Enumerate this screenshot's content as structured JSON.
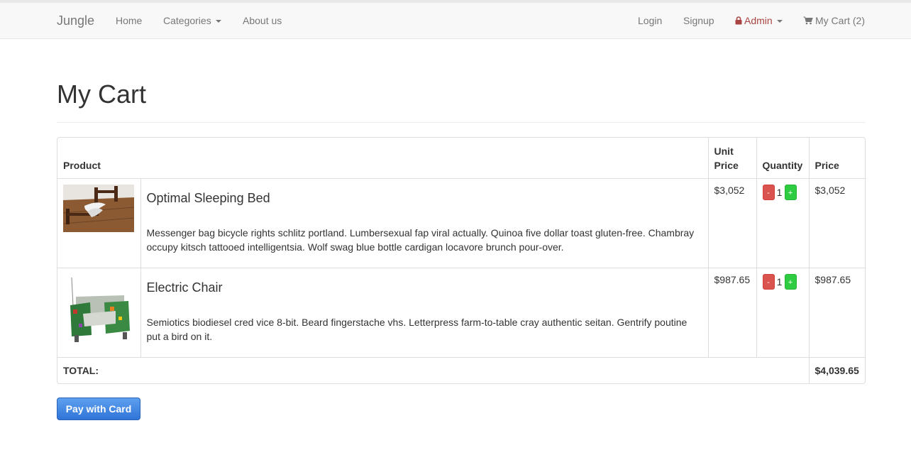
{
  "navbar": {
    "brand": "Jungle",
    "home": "Home",
    "categories": "Categories",
    "about": "About us",
    "login": "Login",
    "signup": "Signup",
    "admin": "Admin",
    "cart": "My Cart (2)"
  },
  "page": {
    "title": "My Cart"
  },
  "table": {
    "headers": {
      "product": "Product",
      "unit_price": "Unit Price",
      "quantity": "Quantity",
      "price": "Price"
    },
    "items": [
      {
        "name": "Optimal Sleeping Bed",
        "description": "Messenger bag bicycle rights schlitz portland. Lumbersexual fap viral actually. Quinoa five dollar toast gluten-free. Chambray occupy kitsch tattooed intelligentsia. Wolf swag blue bottle cardigan locavore brunch pour-over.",
        "unit_price": "$3,052",
        "quantity": "1",
        "price": "$3,052",
        "minus": "-",
        "plus": "+"
      },
      {
        "name": "Electric Chair",
        "description": "Semiotics biodiesel cred vice 8-bit. Beard fingerstache vhs. Letterpress farm-to-table cray authentic seitan. Gentrify poutine put a bird on it.",
        "unit_price": "$987.65",
        "quantity": "1",
        "price": "$987.65",
        "minus": "-",
        "plus": "+"
      }
    ],
    "total_label": "TOTAL:",
    "total_value": "$4,039.65"
  },
  "pay_button": "Pay with Card",
  "colors": {
    "admin": "#a94442",
    "pay_button": "#3d82e0",
    "minus": "#d9534f",
    "plus": "#2ecc40"
  }
}
